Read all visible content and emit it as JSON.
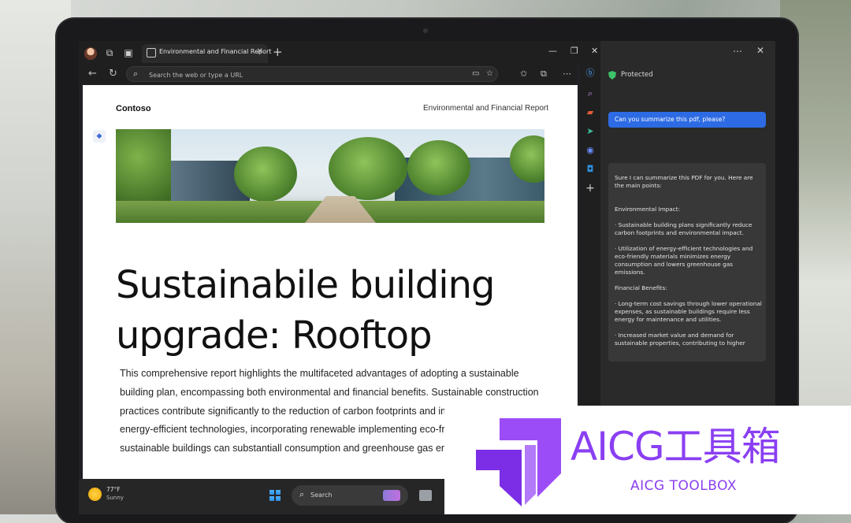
{
  "browser": {
    "tab_title": "Environmental and Financial Report",
    "address_placeholder": "Search the web or type a URL"
  },
  "document": {
    "brand": "Contoso",
    "report_title": "Environmental and Financial Report",
    "headline": "Sustainabile building upgrade: Rooftop",
    "body": "This comprehensive report highlights the multifaceted advantages of adopting a sustainable building plan, encompassing both environmental and financial benefits. Sustainable construction practices contribute significantly to the reduction of carbon footprints and impact. By utilizing energy-efficient technologies, incorporating renewable implementing eco-friendly materials, sustainable buildings can substantiall consumption and greenhouse gas emissions."
  },
  "copilot": {
    "status": "Protected",
    "user_message": "Can you summarize this pdf, please?",
    "response": {
      "intro": "Sure I can summarize this PDF for you. Here are the main points:",
      "env_heading": "Environmental Impact:",
      "env_point_1": "· Sustainable building plans significantly reduce carbon footprints and environmental impact.",
      "env_point_2": "· Utilization of energy-efficient technologies and eco-friendly materials minimizes energy consumption and lowers greenhouse gas emissions.",
      "fin_heading": "Financial Benefits:",
      "fin_point_1": "· Long-term cost savings through lower operational expenses, as sustainable buildings require less energy for maintenance and utilities.",
      "fin_point_2": "· Increased market value and demand for sustainable properties, contributing to higher"
    }
  },
  "taskbar": {
    "temperature": "77°F",
    "weather": "Sunny",
    "search_label": "Search"
  },
  "watermark": {
    "title": "AICG工具箱",
    "subtitle": "AICG TOOLBOX"
  },
  "colors": {
    "accent_blue": "#2d6be4",
    "shield_green": "#3ec26a",
    "watermark_purple": "#8a3ff2"
  },
  "icons": [
    "profile-avatar",
    "collections-icon",
    "tab-actions-icon",
    "back-icon",
    "refresh-icon",
    "search-icon",
    "favorites-icon",
    "copilot-icon",
    "more-icon",
    "close-icon",
    "windows-logo"
  ]
}
